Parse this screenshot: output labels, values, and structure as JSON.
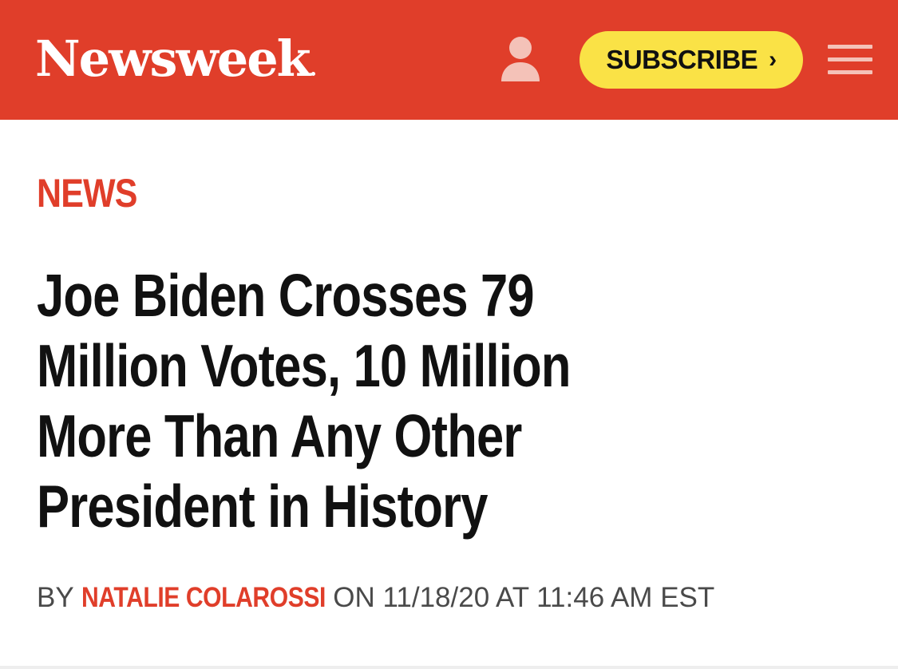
{
  "header": {
    "logo_text": "Newsweek",
    "subscribe_label": "SUBSCRIBE",
    "subscribe_chevron": "›",
    "icons": {
      "account": "user-icon",
      "menu": "hamburger-menu-icon"
    },
    "colors": {
      "brand_red": "#e03e2a",
      "subscribe_yellow": "#fae246"
    }
  },
  "article": {
    "category": "NEWS",
    "headline_lines": [
      "Joe Biden Crosses 79",
      "Million Votes, 10 Million",
      "More Than Any Other",
      "President in History"
    ],
    "byline": {
      "by": "BY",
      "author": "NATALIE COLAROSSI",
      "date_prefix": "ON",
      "datetime": "11/18/20 AT 11:46 AM EST"
    }
  }
}
